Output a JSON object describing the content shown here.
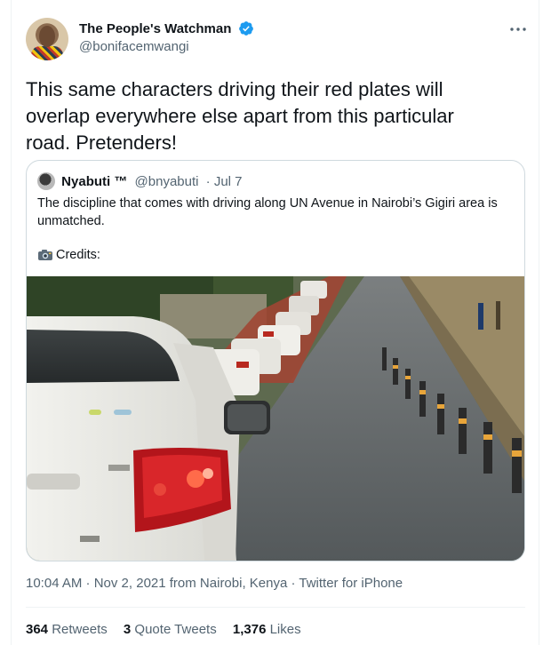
{
  "author": {
    "display_name": "The People's Watchman",
    "handle": "@bonifacemwangi",
    "verified": true
  },
  "tweet": {
    "text_line1": "This same characters driving their red plates will",
    "text_line2": "overlap everywhere else apart from this particular",
    "text_line3": "road. Pretenders!"
  },
  "quoted": {
    "name": "Nyabuti ™",
    "handle": "@bnyabuti",
    "date": "· Jul 7",
    "text_line1": "The discipline that comes with driving along UN Avenue in Nairobi’s Gigiri area is",
    "text_line2": "unmatched.",
    "credits": "Credits:",
    "credits_icon": "camera-emoji"
  },
  "meta": {
    "timestamp": "10:04 AM · Nov 2, 2021 from Nairobi, Kenya · Twitter for iPhone"
  },
  "stats": {
    "retweets_count": "364",
    "retweets_label": "Retweets",
    "quotes_count": "3",
    "quotes_label": "Quote Tweets",
    "likes_count": "1,376",
    "likes_label": "Likes"
  },
  "colors": {
    "accent": "#1d9bf0",
    "text_primary": "#0f1419",
    "text_secondary": "#536471",
    "border": "#cfd9de"
  }
}
